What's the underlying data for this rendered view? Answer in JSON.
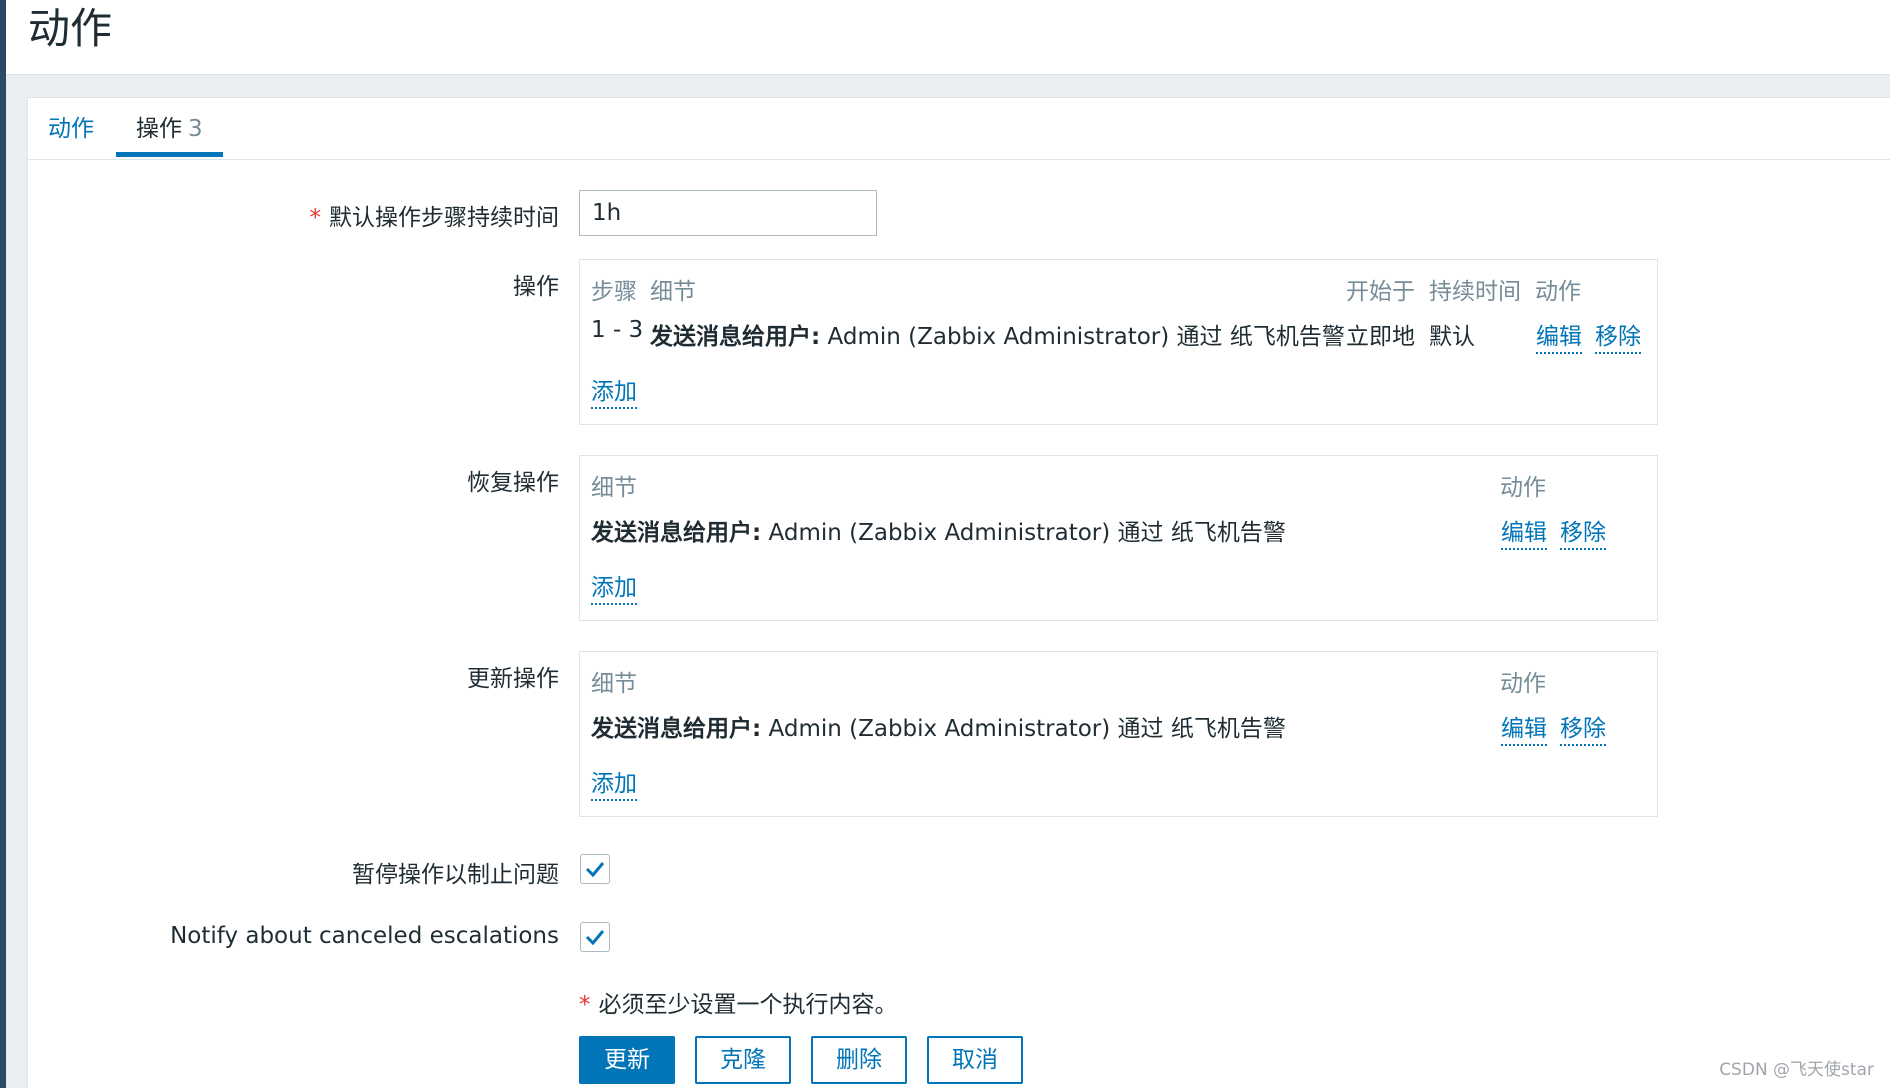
{
  "header": {
    "title": "动作"
  },
  "tabs": [
    {
      "label": "动作"
    },
    {
      "label": "操作",
      "count": "3"
    }
  ],
  "form": {
    "default_duration": {
      "label": "默认操作步骤持续时间",
      "value": "1h"
    },
    "operations": {
      "label": "操作",
      "headers": {
        "steps": "步骤",
        "details": "细节",
        "start_in": "开始于",
        "duration": "持续时间",
        "action": "动作"
      },
      "rows": [
        {
          "steps": "1 - 3",
          "detail_bold": "发送消息给用户:",
          "detail_text": "Admin (Zabbix Administrator) 通过 纸飞机告警",
          "start_in": "立即地",
          "duration": "默认",
          "edit": "编辑",
          "remove": "移除"
        }
      ],
      "add": "添加"
    },
    "recovery": {
      "label": "恢复操作",
      "headers": {
        "details": "细节",
        "action": "动作"
      },
      "rows": [
        {
          "detail_bold": "发送消息给用户:",
          "detail_text": "Admin (Zabbix Administrator) 通过 纸飞机告警",
          "edit": "编辑",
          "remove": "移除"
        }
      ],
      "add": "添加"
    },
    "update": {
      "label": "更新操作",
      "headers": {
        "details": "细节",
        "action": "动作"
      },
      "rows": [
        {
          "detail_bold": "发送消息给用户:",
          "detail_text": "Admin (Zabbix Administrator) 通过 纸飞机告警",
          "edit": "编辑",
          "remove": "移除"
        }
      ],
      "add": "添加"
    },
    "pause": {
      "label": "暂停操作以制止问题",
      "checked": true
    },
    "notify": {
      "label": "Notify about canceled escalations",
      "checked": true
    },
    "note": "必须至少设置一个执行内容。"
  },
  "buttons": {
    "update": "更新",
    "clone": "克隆",
    "delete": "删除",
    "cancel": "取消"
  },
  "watermark": "CSDN @飞天使star",
  "colors": {
    "accent": "#0275b8",
    "required": "#e33734",
    "sidebar": "#2b4a66"
  }
}
